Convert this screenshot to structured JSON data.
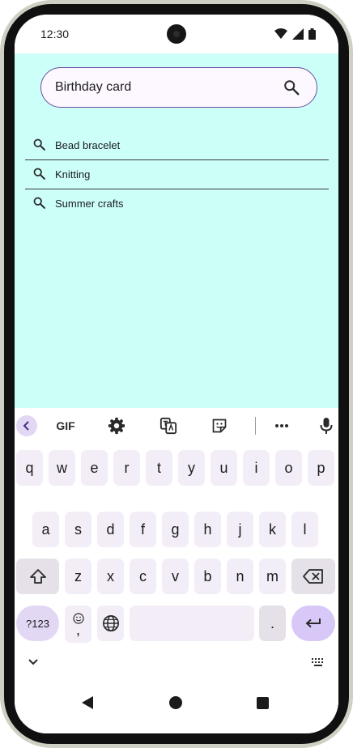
{
  "status": {
    "time": "12:30"
  },
  "search": {
    "query": "Birthday card"
  },
  "suggestions": [
    {
      "label": "Bead bracelet"
    },
    {
      "label": "Knitting"
    },
    {
      "label": "Summer crafts"
    }
  ],
  "keyboard": {
    "toolbar": {
      "gif_label": "GIF"
    },
    "row1": [
      "q",
      "w",
      "e",
      "r",
      "t",
      "y",
      "u",
      "i",
      "o",
      "p"
    ],
    "row2": [
      "a",
      "s",
      "d",
      "f",
      "g",
      "h",
      "j",
      "k",
      "l"
    ],
    "row3": [
      "z",
      "x",
      "c",
      "v",
      "b",
      "n",
      "m"
    ],
    "symbols_label": "?123",
    "emoji_comma_label": ",",
    "period_label": "."
  },
  "colors": {
    "app_background": "#cbfff8",
    "accent": "#6b4ea0"
  }
}
